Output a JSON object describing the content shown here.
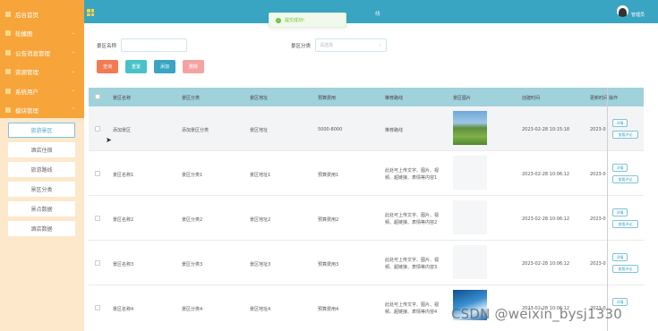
{
  "sidebar": {
    "items": [
      {
        "label": "后台首页",
        "arrow": ""
      },
      {
        "label": "轮播图",
        "arrow": "⌄"
      },
      {
        "label": "公告消息管理",
        "arrow": "⌄"
      },
      {
        "label": "资源管理",
        "arrow": "⌄"
      },
      {
        "label": "系统用户",
        "arrow": "⌄"
      },
      {
        "label": "模块管理",
        "arrow": "⌃"
      }
    ],
    "sub_items": [
      "旅游景区",
      "酒店住宿",
      "旅游路线",
      "景区分类",
      "景点数据",
      "酒店数据"
    ]
  },
  "topbar": {
    "title": "线",
    "user": "管理员"
  },
  "toast": {
    "text": "提交成功!",
    "icon": "check-circle-icon"
  },
  "filters": {
    "name_label": "景区名称",
    "name_value": "",
    "category_label": "景区分类",
    "category_placeholder": "请选择"
  },
  "buttons": {
    "query": "查询",
    "reset": "重置",
    "add": "添加",
    "delete": "删除"
  },
  "colors": {
    "query": "#f27b54",
    "reset": "#49c2c7",
    "add": "#3aa5c2",
    "delete": "#f4a3a3"
  },
  "table": {
    "headers": [
      "景区名称",
      "景区分类",
      "景区地址",
      "预算费用",
      "推荐路线",
      "景区图片",
      "创建时间",
      "更新时间",
      "操作"
    ],
    "rows": [
      {
        "name": "添加景区",
        "category": "添加景区分类",
        "address": "景区地址",
        "budget": "5000-8000",
        "route": "推荐路线",
        "route2": "",
        "created": "2023-02-28 10:15:18",
        "updated": "2023-0",
        "image": "landscape"
      },
      {
        "name": "景区名称1",
        "category": "景区分类1",
        "address": "景区地址1",
        "budget": "预算费用1",
        "route": "此处可上传文字、图片、视",
        "route2": "频、超链接、表情等内容1",
        "created": "2023-02-28 10:06:12",
        "updated": "2023-0",
        "image": ""
      },
      {
        "name": "景区名称2",
        "category": "景区分类2",
        "address": "景区地址2",
        "budget": "预算费用2",
        "route": "此处可上传文字、图片、视",
        "route2": "频、超链接、表情等内容2",
        "created": "2023-02-28 10:06:12",
        "updated": "2023-0",
        "image": ""
      },
      {
        "name": "景区名称3",
        "category": "景区分类3",
        "address": "景区地址3",
        "budget": "预算费用3",
        "route": "此处可上传文字、图片、视",
        "route2": "频、超链接、表情等内容3",
        "created": "2023-02-28 10:06:12",
        "updated": "2023-0",
        "image": ""
      },
      {
        "name": "景区名称4",
        "category": "景区分类4",
        "address": "景区地址4",
        "budget": "预算费用4",
        "route": "此处可上传文字、图片、视",
        "route2": "频、超链接、表情等内容4",
        "created": "2023-02-28 10:06:12",
        "updated": "2023-0",
        "image": "sky"
      }
    ],
    "actions": {
      "detail": "详情",
      "review": "查看评论"
    }
  },
  "watermark": "CSDN @weixin_bysj1330"
}
